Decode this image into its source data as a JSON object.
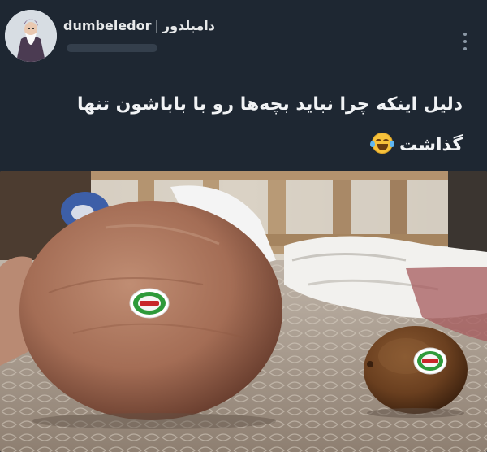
{
  "author": {
    "display_name_latin": "dumbeledor",
    "separator": "|",
    "display_name_persian": "دامبلدور"
  },
  "tweet": {
    "text": "دلیل اینکه چرا نباید بچه‌ها رو با باباشون تنها گذاشت",
    "emoji": "face-with-tears-of-joy"
  },
  "menu": {
    "icon": "more-vertical-icon"
  },
  "colors": {
    "background": "#1e2732",
    "text": "#e7e9ea",
    "sticker_green": "#2e9a3a",
    "sticker_red": "#c8262a"
  }
}
